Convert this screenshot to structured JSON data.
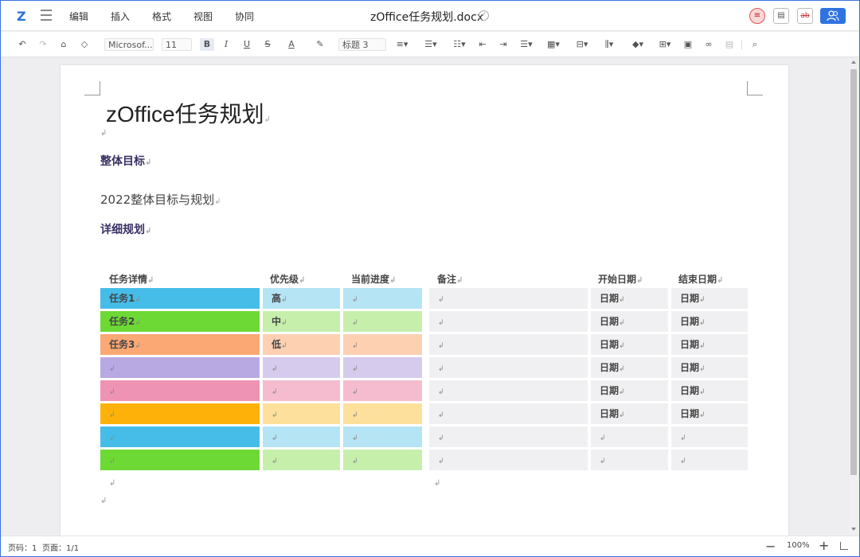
{
  "titlebar": {
    "logo": "Z",
    "menus": [
      "编辑",
      "插入",
      "格式",
      "视图",
      "协同"
    ],
    "doc_title": "zOffice任务规划.docx",
    "btn_strike": "ab"
  },
  "toolbar": {
    "font_name": "Microsof...",
    "font_size": "11",
    "style_name": "标题 3",
    "bold": "B",
    "italic": "I",
    "underline": "U",
    "strike": "S",
    "font_color": "A"
  },
  "document": {
    "title": "zOffice任务规划",
    "heading1": "整体目标",
    "body1": "2022整体目标与规划",
    "heading2": "详细规划",
    "para_mark": "↲",
    "table": {
      "headers": [
        "任务详情",
        "优先级",
        "当前进度",
        "备注",
        "开始日期",
        "结束日期"
      ],
      "rows": [
        {
          "task": "任务1",
          "priority": "高",
          "start": "日期",
          "end": "日期"
        },
        {
          "task": "任务2",
          "priority": "中",
          "start": "日期",
          "end": "日期"
        },
        {
          "task": "任务3",
          "priority": "低",
          "start": "日期",
          "end": "日期"
        },
        {
          "task": "",
          "priority": "",
          "start": "日期",
          "end": "日期"
        },
        {
          "task": "",
          "priority": "",
          "start": "日期",
          "end": "日期"
        },
        {
          "task": "",
          "priority": "",
          "start": "日期",
          "end": "日期"
        },
        {
          "task": "",
          "priority": "",
          "start": "",
          "end": ""
        },
        {
          "task": "",
          "priority": "",
          "start": "",
          "end": ""
        }
      ],
      "row_colors": [
        {
          "dark": "#46bde8",
          "light": "#b5e4f5"
        },
        {
          "dark": "#6dd935",
          "light": "#c6efac"
        },
        {
          "dark": "#fba874",
          "light": "#fdd0b2"
        },
        {
          "dark": "#b9a9e3",
          "light": "#d6cbec"
        },
        {
          "dark": "#ef93b4",
          "light": "#f5bccf"
        },
        {
          "dark": "#feb108",
          "light": "#fde09c"
        },
        {
          "dark": "#46bde8",
          "light": "#b5e4f5"
        },
        {
          "dark": "#6dd935",
          "light": "#c6efac"
        }
      ],
      "gray_cell": "#f0f0f2"
    }
  },
  "statusbar": {
    "page_num": "页码：1",
    "pages": "页面：1/1",
    "zoom": "100%"
  }
}
